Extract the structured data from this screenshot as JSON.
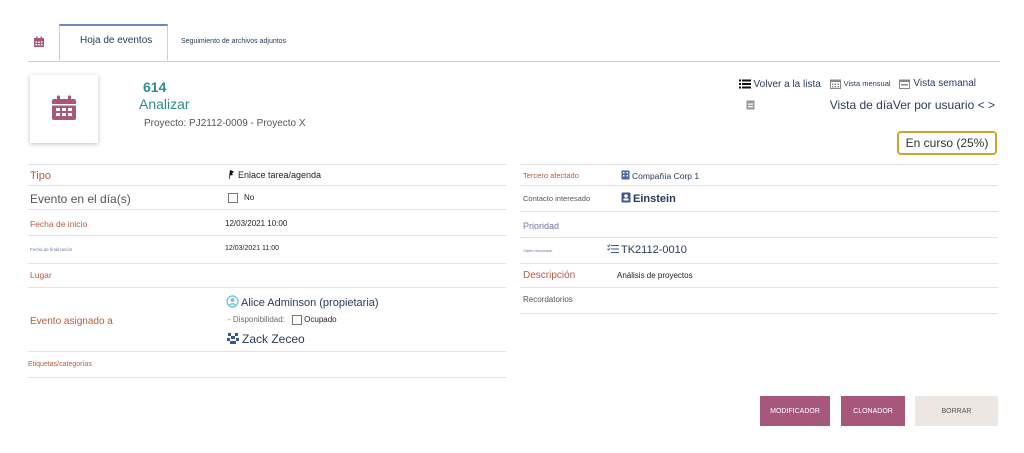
{
  "tabs": {
    "active_label": "Hoja de eventos",
    "second_label": "Seguimiento de archivos adjuntos"
  },
  "header": {
    "ref": "614",
    "label": "Analizar",
    "project": "Proyecto: PJ2112-0009 - Proyecto X"
  },
  "nav": {
    "back_to_list": "Volver a la lista",
    "monthly_view": "Vista mensual",
    "weekly_view": "Vista semanal",
    "day_view": "Vista de día",
    "by_user_view": "Ver por usuario",
    "prev": "<",
    "next": ">"
  },
  "status": "En curso (25%)",
  "left_fields": {
    "type_label": "Tipo",
    "type_value": "Enlace tarea/agenda",
    "allday_label": "Evento en el día(s)",
    "allday_value": "No",
    "start_label": "Fecha de inicio",
    "start_value": "12/03/2021 10:00",
    "end_label": "Fecha de finalización",
    "end_value": "12/03/2021 11:00",
    "location_label": "Lugar",
    "assigned_label": "Evento asignado a",
    "assigned_owner": "Alice Adminson (propietaria)",
    "availability_label": "- Disponibilidad:",
    "availability_value": "Ocupado",
    "assigned_other": "Zack Zeceo",
    "tags_label": "Etiquetas/categorías"
  },
  "right_fields": {
    "thirdparty_label": "Tercero afectado",
    "thirdparty_value": "Compañía Corp 1",
    "contact_label": "Contacto interesado",
    "contact_value": "Einstein",
    "priority_label": "Prioridad",
    "linked_label": "Objeto relacionado",
    "linked_value": "TK2112-0010",
    "desc_label": "Descripción",
    "desc_value": "Análisis de proyectos",
    "reminders_label": "Recordatorios"
  },
  "buttons": {
    "modify": "MODIFICADOR",
    "clone": "CLONADOR",
    "delete": "BORRAR"
  },
  "colors": {
    "accent": "#a8577c",
    "label_text": "#b35d3d",
    "link": "#263c5c",
    "teal": "#2f8a8c",
    "status_border": "#c9a830"
  },
  "icons": [
    "calendar-icon",
    "list-icon",
    "user-icon",
    "company-icon",
    "contact-icon",
    "ticket-icon"
  ]
}
